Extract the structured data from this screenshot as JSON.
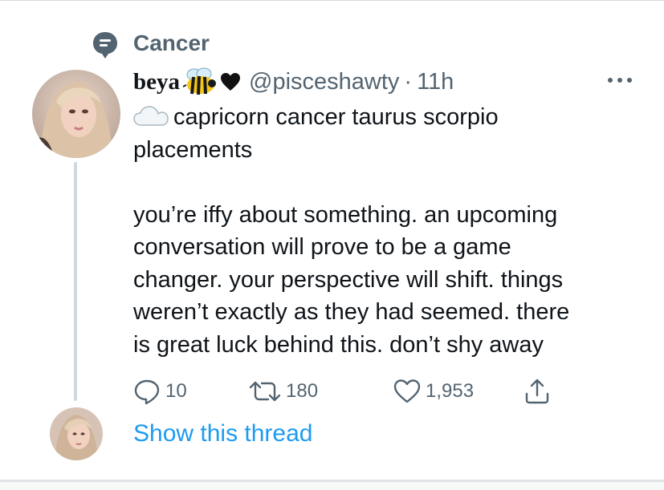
{
  "context": {
    "label": "Cancer",
    "icon": "topic-icon"
  },
  "tweet": {
    "author_name": "beya",
    "name_emojis": [
      "bee-emoji",
      "black-heart-icon"
    ],
    "handle": "@pisceshawty",
    "separator": "·",
    "timestamp": "11h",
    "text_lines": [
      "capricorn cancer taurus scorpio",
      "placements",
      "",
      "you’re iffy about something. an upcoming",
      "conversation will prove to be a game",
      "changer. your perspective will shift. things",
      "weren’t exactly as they had seemed. there",
      "is great luck behind this. don’t shy away"
    ],
    "leading_emoji": "cloud-emoji",
    "stats": {
      "replies": "10",
      "retweets": "180",
      "likes": "1,953"
    }
  },
  "thread_link": {
    "label": "Show this thread"
  },
  "colors": {
    "accent": "#1d9bf0",
    "muted": "#536471",
    "text": "#0f1419",
    "thread_line": "#cfd9de"
  }
}
